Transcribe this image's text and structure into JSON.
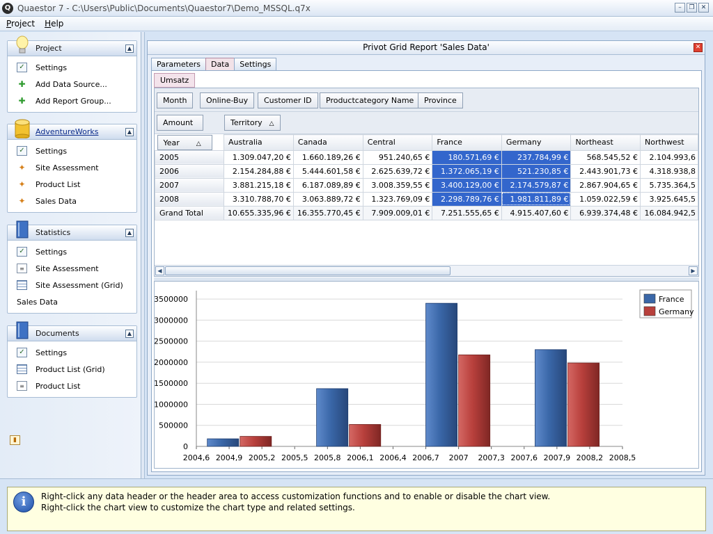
{
  "window": {
    "title": "Quaestor 7 - C:\\Users\\Public\\Documents\\Quaestor7\\Demo_MSSQL.q7x",
    "icon_letter": "Q",
    "controls": [
      "minimize-icon",
      "restore-icon",
      "close-icon"
    ]
  },
  "menu": [
    "Project",
    "Help"
  ],
  "sidebar": {
    "groups": [
      {
        "title": "Project",
        "icon": "lightbulb-icon",
        "link": false,
        "items": [
          {
            "label": "Settings",
            "icon": "check"
          },
          {
            "label": "Add Data Source...",
            "icon": "add"
          },
          {
            "label": "Add Report Group...",
            "icon": "add"
          }
        ]
      },
      {
        "title": "AdventureWorks",
        "icon": "database-icon",
        "link": true,
        "items": [
          {
            "label": "Settings",
            "icon": "check"
          },
          {
            "label": "Site Assessment",
            "icon": "puzzle"
          },
          {
            "label": "Product List",
            "icon": "puzzle"
          },
          {
            "label": "Sales Data",
            "icon": "puzzle"
          }
        ]
      },
      {
        "title": "Statistics",
        "icon": "book-icon",
        "link": false,
        "items": [
          {
            "label": "Settings",
            "icon": "check"
          },
          {
            "label": "Site Assessment",
            "icon": "doc"
          },
          {
            "label": "Site Assessment (Grid)",
            "icon": "grid"
          },
          {
            "label": "Sales Data",
            "icon": "chart"
          }
        ]
      },
      {
        "title": "Documents",
        "icon": "book-icon",
        "link": false,
        "items": [
          {
            "label": "Settings",
            "icon": "check"
          },
          {
            "label": "Product List (Grid)",
            "icon": "grid"
          },
          {
            "label": "Product List",
            "icon": "doc"
          }
        ]
      }
    ]
  },
  "panel": {
    "title": "Privot Grid Report 'Sales Data'",
    "tabs": [
      "Parameters",
      "Data",
      "Settings"
    ],
    "active_tab": "Data",
    "subtab": "Umsatz"
  },
  "pivot": {
    "filter_fields": [
      "Month",
      "Online-Buy",
      "Customer ID",
      "Productcategory Name",
      "Province"
    ],
    "data_field": "Amount",
    "column_field": "Territory",
    "row_field": "Year",
    "sort_glyph": "△",
    "columns": [
      "Australia",
      "Canada",
      "Central",
      "France",
      "Germany",
      "Northeast",
      "Northwest"
    ],
    "rows": [
      {
        "label": "2005",
        "values": [
          "1.309.047,20 €",
          "1.660.189,26 €",
          "951.240,65 €",
          "180.571,69 €",
          "237.784,99 €",
          "568.545,52 €",
          "2.104.993,6"
        ]
      },
      {
        "label": "2006",
        "values": [
          "2.154.284,88 €",
          "5.444.601,58 €",
          "2.625.639,72 €",
          "1.372.065,19 €",
          "521.230,85 €",
          "2.443.901,73 €",
          "4.318.938,8"
        ]
      },
      {
        "label": "2007",
        "values": [
          "3.881.215,18 €",
          "6.187.089,89 €",
          "3.008.359,55 €",
          "3.400.129,00 €",
          "2.174.579,87 €",
          "2.867.904,65 €",
          "5.735.364,5"
        ]
      },
      {
        "label": "2008",
        "values": [
          "3.310.788,70 €",
          "3.063.889,72 €",
          "1.323.769,09 €",
          "2.298.789,76 €",
          "1.981.811,89 €",
          "1.059.022,59 €",
          "3.925.645,5"
        ]
      }
    ],
    "total": {
      "label": "Grand Total",
      "values": [
        "10.655.335,96 €",
        "16.355.770,45 €",
        "7.909.009,01 €",
        "7.251.555,65 €",
        "4.915.407,60 €",
        "6.939.374,48 €",
        "16.084.942,5"
      ]
    },
    "selected_columns": [
      3,
      4
    ]
  },
  "chart_data": {
    "type": "bar",
    "categories": [
      "2005",
      "2006",
      "2007",
      "2008"
    ],
    "x_centers": [
      2005,
      2006,
      2007,
      2008
    ],
    "series": [
      {
        "name": "France",
        "values": [
          180571.69,
          1372065.19,
          3400129.0,
          2298789.76
        ],
        "color": "#3a67a8"
      },
      {
        "name": "Germany",
        "values": [
          237784.99,
          521230.85,
          2174579.87,
          1981811.89
        ],
        "color": "#b8403c"
      }
    ],
    "xlim": [
      2004.6,
      2008.5
    ],
    "ylim": [
      0,
      3700000
    ],
    "x_ticks": [
      "2004,6",
      "2004,9",
      "2005,2",
      "2005,5",
      "2005,8",
      "2006,1",
      "2006,4",
      "2006,7",
      "2007",
      "2007,3",
      "2007,6",
      "2007,9",
      "2008,2",
      "2008,5"
    ],
    "y_ticks": [
      "0",
      "500000",
      "1000000",
      "1500000",
      "2000000",
      "2500000",
      "3000000",
      "3500000"
    ],
    "legend": "top-right",
    "grid": true
  },
  "info": {
    "line1": "Right-click any data header or the header area to access customization functions and to enable or disable the chart view.",
    "line2": "Right-click the chart view to customize the chart type and related settings."
  }
}
